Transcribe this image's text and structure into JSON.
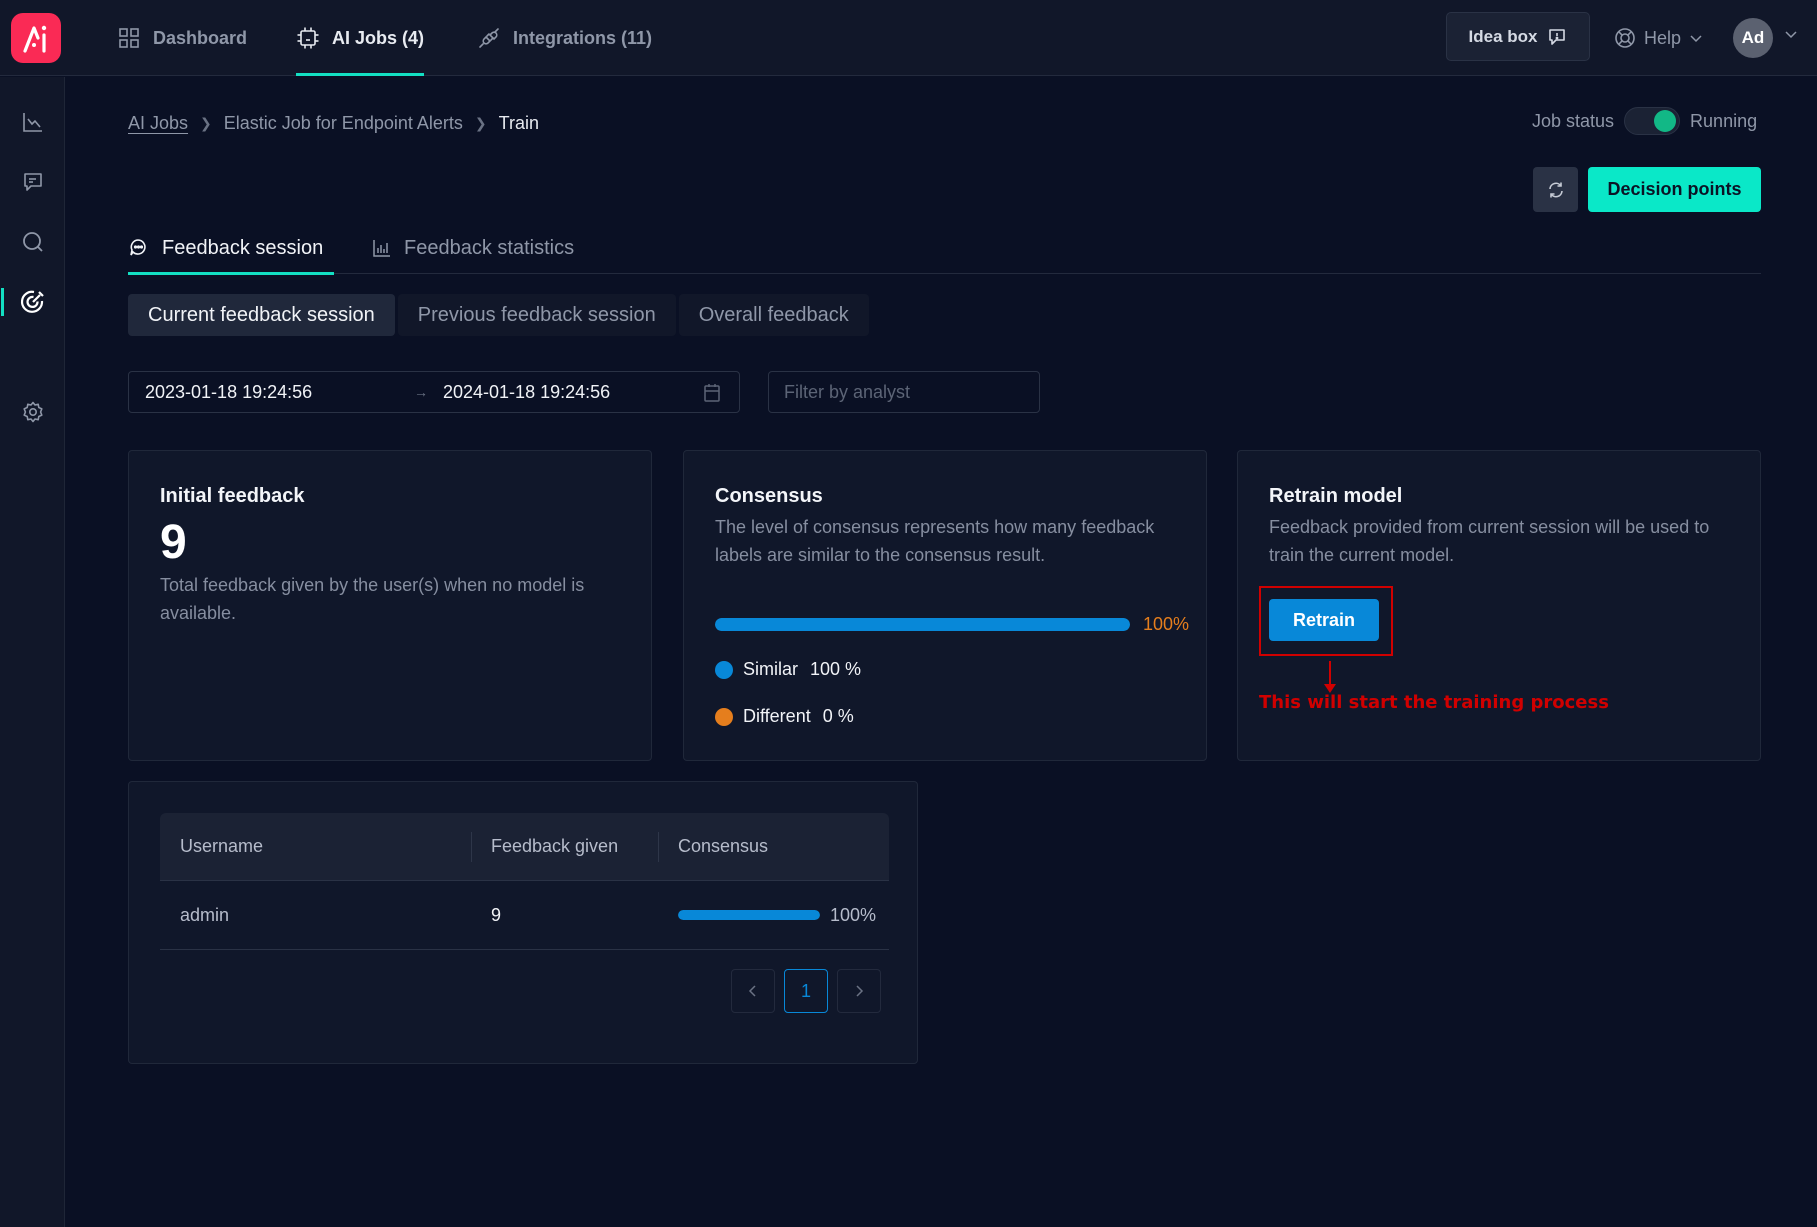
{
  "header": {
    "logo_text": "AI",
    "nav": [
      {
        "label": "Dashboard",
        "icon": "grid-icon",
        "active": false
      },
      {
        "label": "AI Jobs (4)",
        "icon": "chip-icon",
        "active": true
      },
      {
        "label": "Integrations (11)",
        "icon": "plug-icon",
        "active": false
      }
    ],
    "idea_box_label": "Idea box",
    "help_label": "Help",
    "avatar_initials": "Ad"
  },
  "sidebar": {
    "items": [
      {
        "icon": "line-chart-icon",
        "active": false
      },
      {
        "icon": "message-icon",
        "active": false
      },
      {
        "icon": "search-icon",
        "active": false
      },
      {
        "icon": "target-icon",
        "active": true
      },
      {
        "icon": "gear-icon",
        "active": false
      }
    ]
  },
  "breadcrumb": {
    "items": [
      "AI Jobs",
      "Elastic Job for Endpoint Alerts",
      "Train"
    ]
  },
  "job_status": {
    "label": "Job status",
    "value": "Running",
    "enabled": true
  },
  "actions": {
    "decision_points_label": "Decision points"
  },
  "tabs": [
    {
      "label": "Feedback session",
      "active": true
    },
    {
      "label": "Feedback statistics",
      "active": false
    }
  ],
  "segments": [
    {
      "label": "Current feedback session",
      "active": true
    },
    {
      "label": "Previous feedback session",
      "active": false
    },
    {
      "label": "Overall feedback",
      "active": false
    }
  ],
  "filters": {
    "date_from": "2023-01-18 19:24:56",
    "date_to": "2024-01-18 19:24:56",
    "date_separator": "→",
    "analyst_placeholder": "Filter by analyst",
    "analyst_value": ""
  },
  "cards": {
    "initial": {
      "title": "Initial feedback",
      "value": "9",
      "description": "Total feedback given by the user(s) when no model is available."
    },
    "consensus": {
      "title": "Consensus",
      "description": "The level of consensus represents how many feedback labels are similar to the consensus result.",
      "percent": 100,
      "percent_label": "100%",
      "legend": [
        {
          "label": "Similar",
          "value": "100 %",
          "color": "#0888d8"
        },
        {
          "label": "Different",
          "value": "0 %",
          "color": "#e57e1d"
        }
      ]
    },
    "retrain": {
      "title": "Retrain model",
      "description": "Feedback provided from current session will be used to train the current model.",
      "button_label": "Retrain",
      "annotation": "This will start the training process"
    }
  },
  "table": {
    "columns": [
      "Username",
      "Feedback given",
      "Consensus"
    ],
    "rows": [
      {
        "username": "admin",
        "feedback_given": "9",
        "consensus_percent": 100,
        "consensus_label": "100%"
      }
    ],
    "pagination": {
      "current_page": "1"
    }
  },
  "colors": {
    "accent": "#13e0c3",
    "primary": "#0888d8",
    "warning": "#e57e1d",
    "brand": "#fa2a55",
    "status_on": "#12b886"
  }
}
